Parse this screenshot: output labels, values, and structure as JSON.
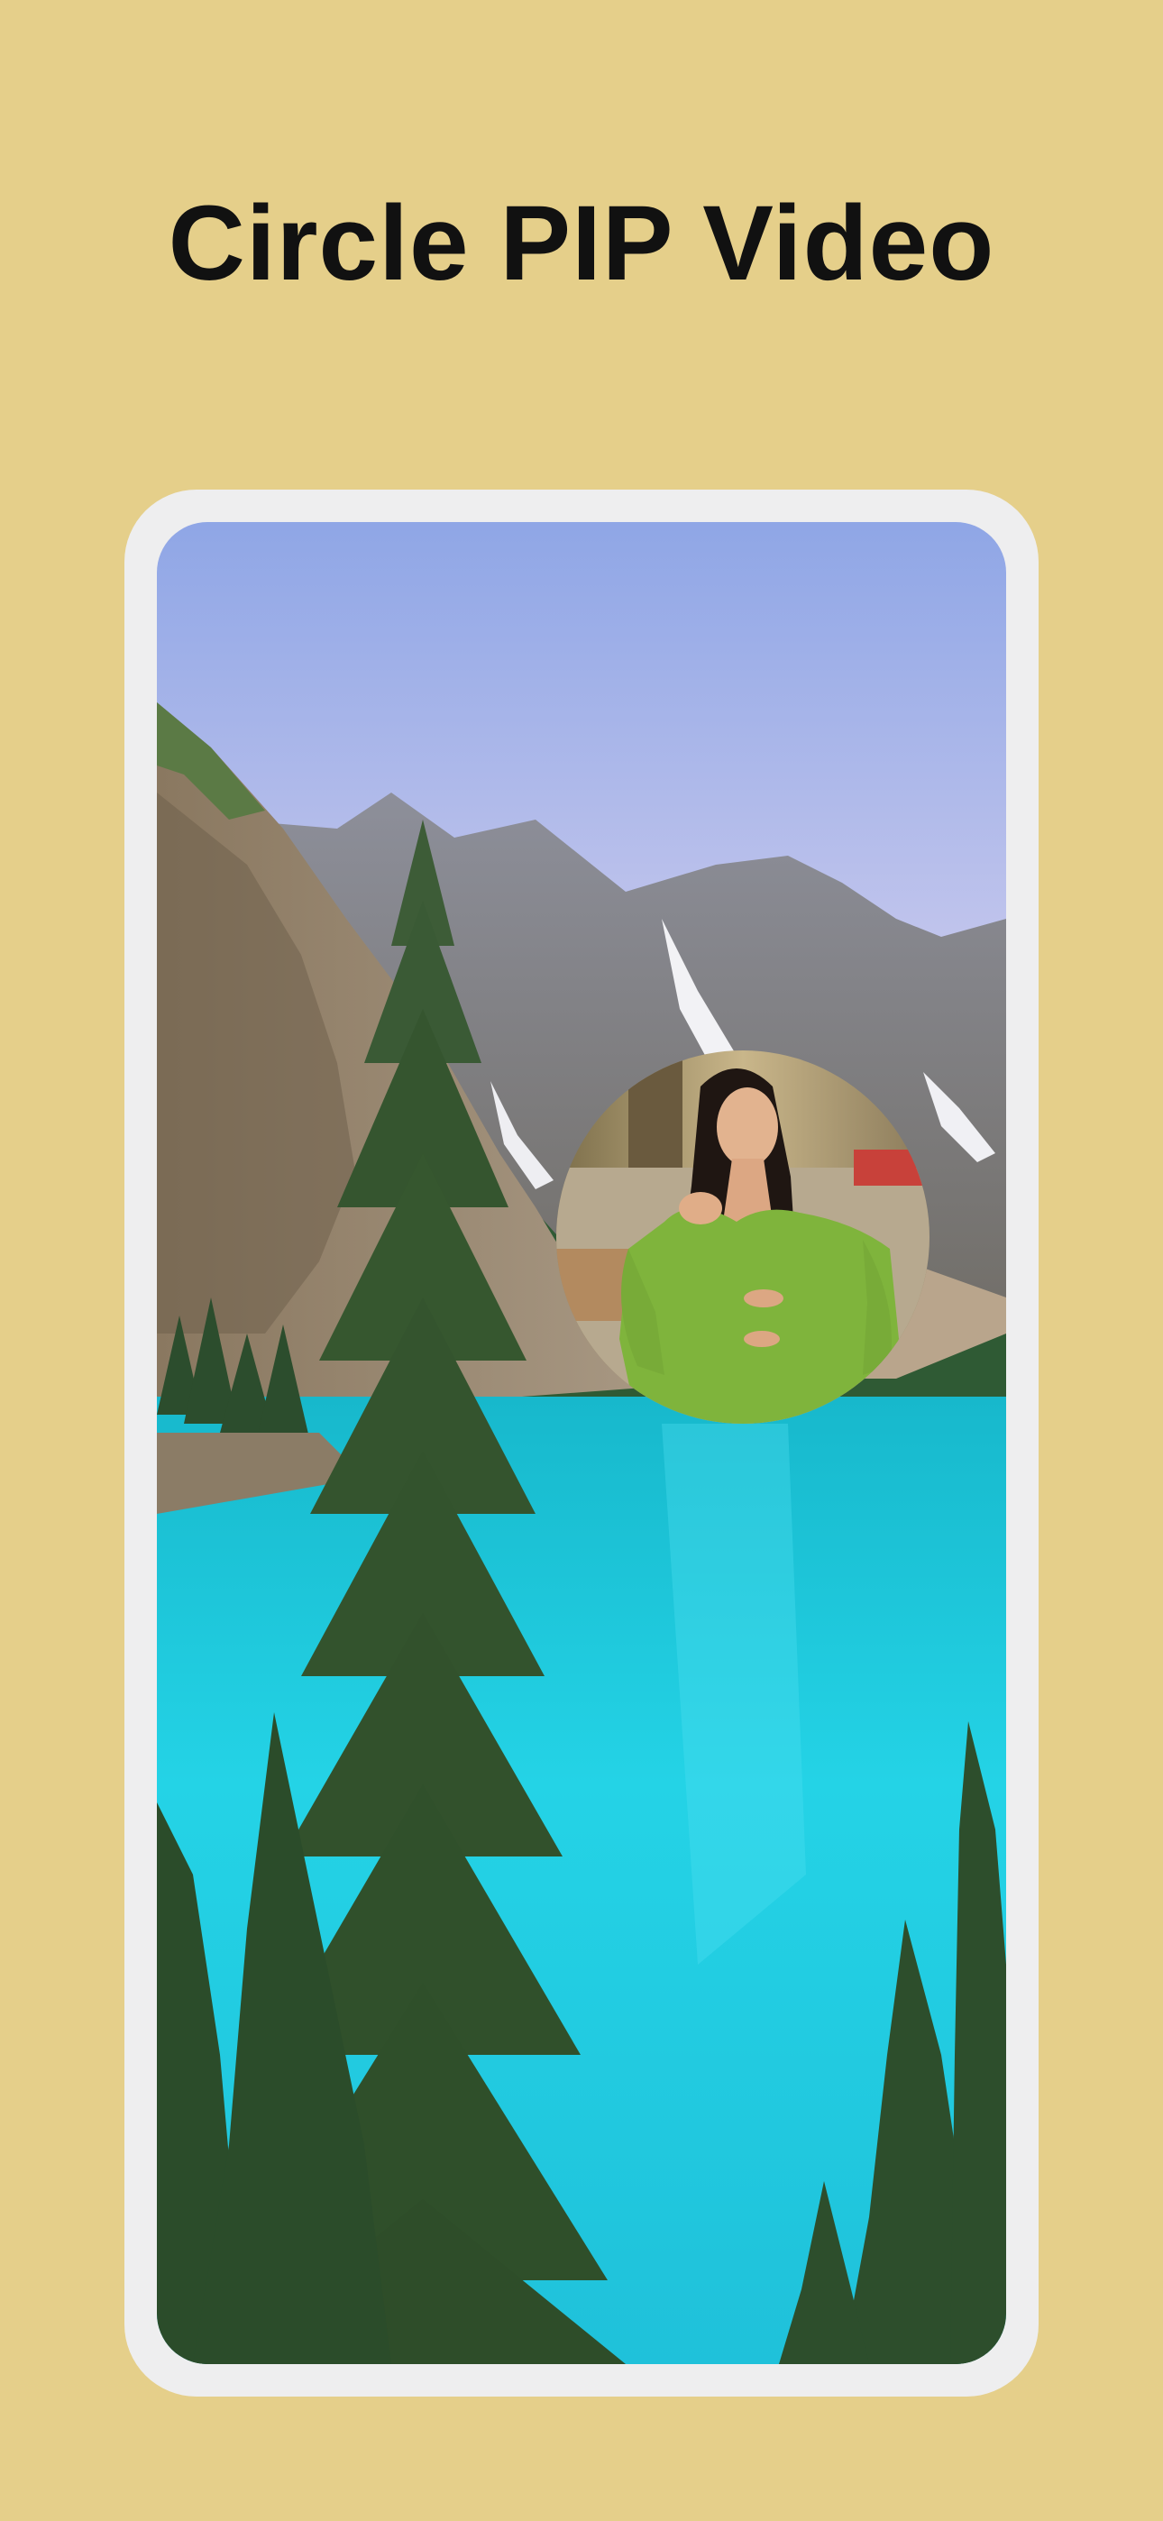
{
  "headline": "Circle PIP Video",
  "colors": {
    "background": "#e5cf8a",
    "frame": "#eeeeef",
    "lake": "#22c8de",
    "forest": "#2f5a34",
    "sky": "#c9c9ea",
    "pip_dress": "#7fb43c"
  },
  "phone": {
    "background_scene": "mountain-lake-wallpaper",
    "pip": {
      "shape": "circle",
      "content": "woman-in-green-dress-video"
    }
  }
}
